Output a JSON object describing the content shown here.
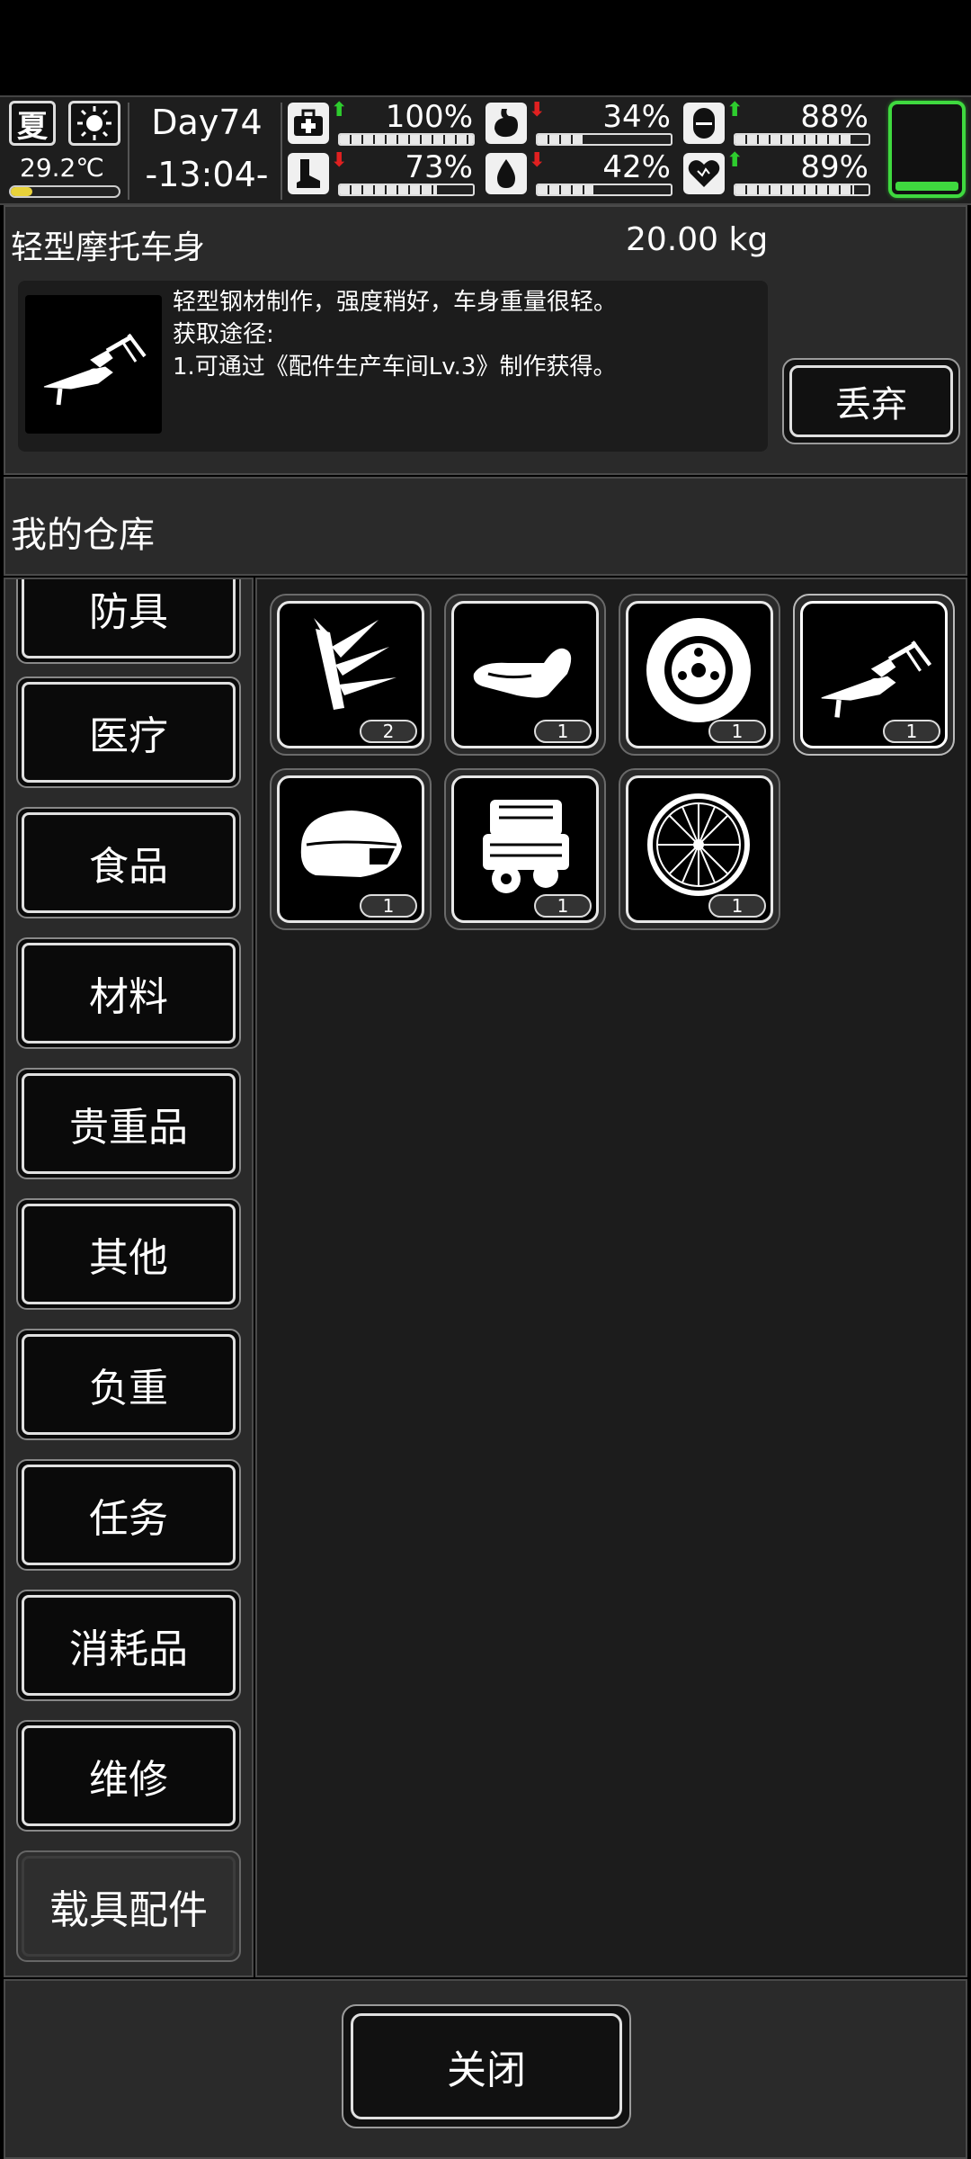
{
  "status": {
    "season": "夏",
    "weather_icon": "sun-icon",
    "temperature": "29.2℃",
    "temperature_level": 0.2,
    "day": "Day74",
    "time": "-13:04-",
    "stats": [
      {
        "icon": "medkit-icon",
        "trend": "up",
        "value": "100%",
        "level": 1.0
      },
      {
        "icon": "stomach-icon",
        "trend": "down",
        "value": "34%",
        "level": 0.34
      },
      {
        "icon": "pill-icon",
        "trend": "up",
        "value": "88%",
        "level": 0.88
      },
      {
        "icon": "boot-icon",
        "trend": "down",
        "value": "73%",
        "level": 0.73
      },
      {
        "icon": "water-drop-icon",
        "trend": "down",
        "value": "42%",
        "level": 0.42
      },
      {
        "icon": "heart-icon",
        "trend": "up",
        "value": "89%",
        "level": 0.89
      }
    ],
    "battery_level": 0.1,
    "colors": {
      "battery": "#3fd93f",
      "up": "#2ecc2e",
      "down": "#e02020",
      "temp": "#e8d23a"
    }
  },
  "detail": {
    "name": "轻型摩托车身",
    "weight": "20.00 kg",
    "description_line1": "轻型钢材制作，强度稍好，车身重量很轻。",
    "description_line2": "获取途径:",
    "description_line3": "1.可通过《配件生产车间Lv.3》制作获得。",
    "discard_label": "丢弃"
  },
  "warehouse": {
    "title": "我的仓库",
    "categories": [
      {
        "label": "防具"
      },
      {
        "label": "医疗"
      },
      {
        "label": "食品"
      },
      {
        "label": "材料"
      },
      {
        "label": "贵重品"
      },
      {
        "label": "其他"
      },
      {
        "label": "负重"
      },
      {
        "label": "任务"
      },
      {
        "label": "消耗品"
      },
      {
        "label": "维修"
      },
      {
        "label": "载具配件",
        "active": true
      }
    ],
    "items": [
      {
        "icon": "spiked-part-icon",
        "count": "2"
      },
      {
        "icon": "scooter-seat-icon",
        "count": "1"
      },
      {
        "icon": "tire-icon",
        "count": "1"
      },
      {
        "icon": "motorcycle-frame-icon",
        "count": "1",
        "selected": true
      },
      {
        "icon": "fuel-tank-icon",
        "count": "1"
      },
      {
        "icon": "engine-icon",
        "count": "1"
      },
      {
        "icon": "spoked-wheel-icon",
        "count": "1"
      }
    ]
  },
  "footer": {
    "close_label": "关闭"
  }
}
